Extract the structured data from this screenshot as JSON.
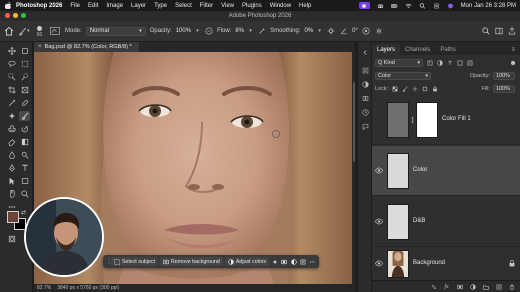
{
  "menubar": {
    "app_name": "Photoshop 2026",
    "items": [
      "File",
      "Edit",
      "Image",
      "Layer",
      "Type",
      "Select",
      "Filter",
      "View",
      "Plugins",
      "Window",
      "Help"
    ],
    "clock": "Mon Jan 26  3:28 PM"
  },
  "window": {
    "title": "Adobe Photoshop 2026"
  },
  "options": {
    "brush_size": "60",
    "mode_label": "Mode:",
    "mode_value": "Normal",
    "opacity_label": "Opacity:",
    "opacity_value": "100%",
    "flow_label": "Flow:",
    "flow_value": "8%",
    "smoothing_label": "Smoothing:",
    "smoothing_value": "0%",
    "angle_value": "0°"
  },
  "document": {
    "tab_title": "Bag.psd @ 82.7% (Color, RGB/8) *",
    "zoom": "82.7%",
    "dimensions": "3840 px x 5760 px (300 ppi)"
  },
  "taskbar": {
    "select_subject": "Select subject",
    "remove_background": "Remove background",
    "adjust_colors": "Adjust colors"
  },
  "panel": {
    "tabs": [
      "Layers",
      "Channels",
      "Paths"
    ],
    "active_tab": "Layers",
    "kind_label": "Q Kind",
    "blend_mode": "Color",
    "opacity_label": "Opacity:",
    "opacity_value": "100%",
    "lock_label": "Lock:",
    "fill_label": "Fill:",
    "fill_value": "100%",
    "layers": [
      {
        "name": "Color Fill 1",
        "visible": false,
        "selected": false,
        "thumb_color": "#6f6f6f",
        "has_mask": true,
        "locked": false
      },
      {
        "name": "Color",
        "visible": true,
        "selected": true,
        "thumb_color": "#d9d9d9",
        "has_mask": false,
        "locked": false
      },
      {
        "name": "D&B",
        "visible": true,
        "selected": false,
        "thumb_color": "#dcdcdc",
        "has_mask": false,
        "locked": false
      },
      {
        "name": "Background",
        "visible": true,
        "selected": false,
        "thumb_color": "photo",
        "has_mask": false,
        "locked": true
      }
    ]
  },
  "colors": {
    "foreground": "#6b4438",
    "background": "#000000",
    "accent_badge": "#7b3fe4"
  }
}
